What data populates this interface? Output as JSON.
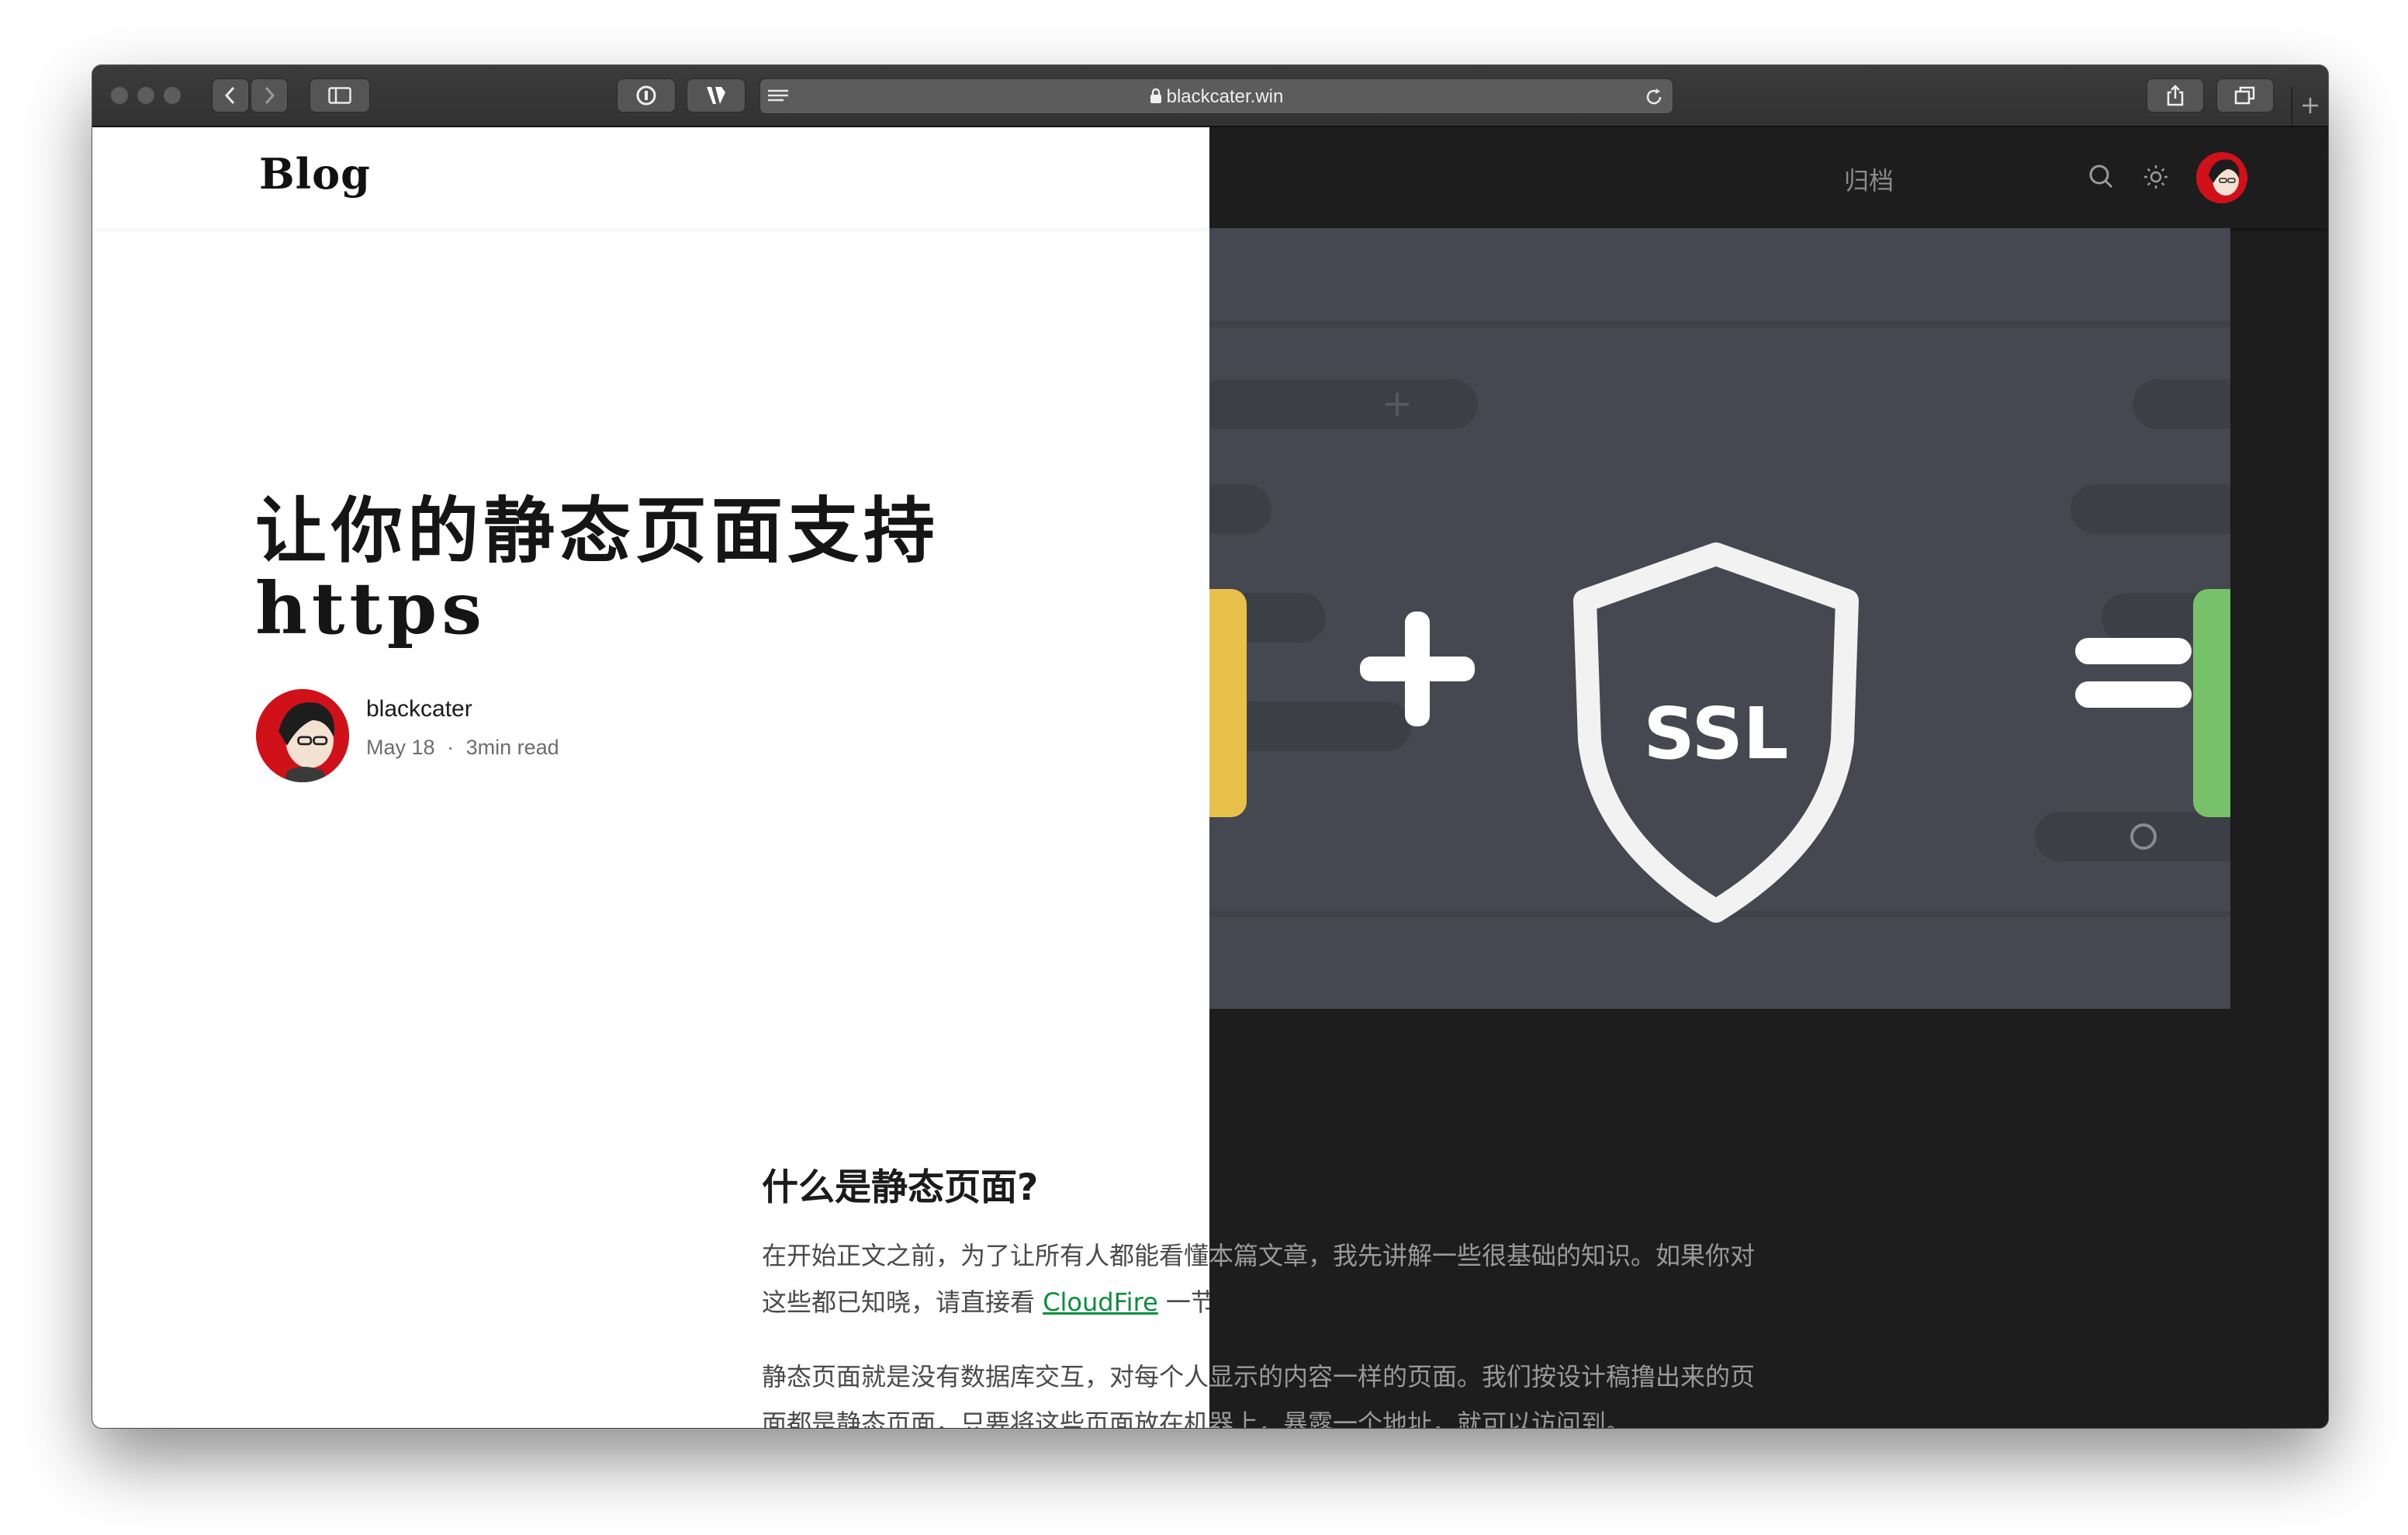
{
  "browser": {
    "url": "blackcater.win",
    "colors": {
      "toolbar": "#363636",
      "url_bar": "#5c5c5c"
    }
  },
  "site": {
    "logo": "Blog",
    "nav_archive": "归档",
    "colors": {
      "light_bg": "#ffffff",
      "dark_bg": "#1d1d1d",
      "hero_bg": "#464851",
      "link": "#0a8f3d",
      "yellow": "#e8c14a",
      "green": "#77c16b"
    }
  },
  "post": {
    "title_line1": "让你的静态页面支持",
    "title_line2": "https",
    "author": "blackcater",
    "date": "May 18",
    "separator": "·",
    "read_time": "3min read",
    "hero_text": "SSL",
    "section_heading": "什么是静态页面?",
    "paragraph1_line1": "在开始正文之前，为了让所有人都能看懂本篇文章，我先讲解一些很基础的知识。如果你对",
    "paragraph1_line2_before": "这些都已知晓，请直接看 ",
    "paragraph1_link": "CloudFire",
    "paragraph1_line2_after": " 一节。",
    "paragraph2_line1": "静态页面就是没有数据库交互，对每个人显示的内容一样的页面。我们按设计稿撸出来的页",
    "paragraph2_line2": "面都是静态页面，只要将这些页面放在机器上，暴露一个地址，就可以访问到。"
  }
}
